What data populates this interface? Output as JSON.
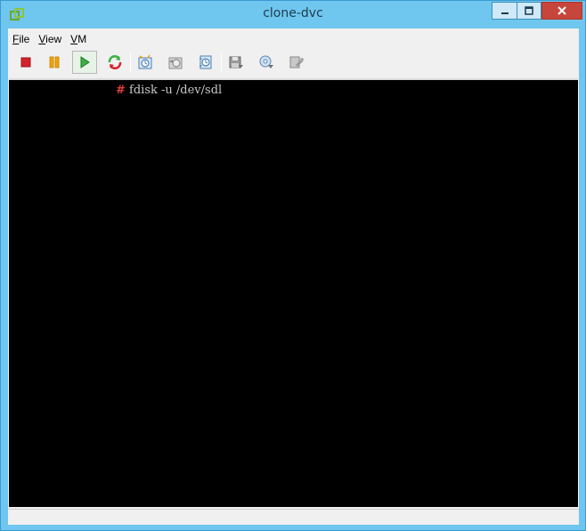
{
  "window": {
    "title": "clone-dvc",
    "controls": {
      "minimize_icon": "minimize-icon",
      "maximize_icon": "maximize-icon",
      "close_icon": "close-icon"
    },
    "accent_color": "#6fc6ee",
    "close_color": "#c7463c"
  },
  "menu": {
    "file": {
      "underline": "F",
      "rest": "ile"
    },
    "view": {
      "underline": "V",
      "rest": "iew"
    },
    "vm": {
      "underline": "V",
      "rest": "M"
    }
  },
  "toolbar": {
    "buttons": [
      {
        "icon": "stop-icon",
        "active": false
      },
      {
        "icon": "pause-icon",
        "active": false
      },
      {
        "icon": "play-icon",
        "active": true
      },
      {
        "icon": "reset-icon",
        "active": false
      },
      {
        "icon": "snapshot-icon",
        "active": false
      },
      {
        "icon": "revert-snapshot-icon",
        "active": false
      },
      {
        "icon": "snapshot-manager-icon",
        "active": false
      },
      {
        "icon": "floppy-icon",
        "active": false
      },
      {
        "icon": "cd-icon",
        "active": false
      },
      {
        "icon": "vm-settings-icon",
        "active": false
      }
    ]
  },
  "console": {
    "prompt": "#",
    "command": " fdisk -u /dev/sdl"
  }
}
